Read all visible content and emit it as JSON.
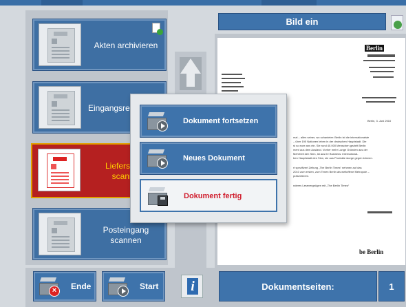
{
  "left_list": {
    "items": [
      {
        "label": "Akten archivieren",
        "active": false
      },
      {
        "label": "Eingangsre",
        "active": false
      },
      {
        "label": "Lieferschei\nscanne",
        "active": true
      },
      {
        "label": "Posteingang\nscannen",
        "active": false
      }
    ]
  },
  "right_panel": {
    "header": "Bild ein"
  },
  "preview": {
    "logo_top": "Berlin",
    "logo_bottom": "be Berlin",
    "date": "Berlin, 3. Juni 2010",
    "body_lines": [
      "mal – allen seiner, wo schanieter: Berlin ist die internationalste",
      "– über 190 Nationen leben in der deutschen Hauptstadt. Die",
      "st so eure ans ein. Sie rund 40.000 Menschen gezielt Berlin",
      "ment aus dem Ausland. Vorher mehr Lange Gründen aus der",
      "Mehrheit den Sinn, ist aus ihr Business: international-",
      "ben Hauptstadt den Sinn, sie aus Produkte storge gegen können."
    ],
    "body_lines_2": [
      "rt spezifizert Zeitung „The Berlin Times“ nehmen auf das",
      "2010 zum ersten, zum Tenen Berlin als weltoffene Metropole –",
      "präsentieren."
    ],
    "closing": "nderes Lesevergnügen mit „The Berlin Times“"
  },
  "popup_menu": {
    "continue_label": "Dokument fortsetzen",
    "new_label": "Neues Dokument",
    "finish_label": "Dokument fertig"
  },
  "bottom_bar": {
    "end_label": "Ende",
    "start_label": "Start",
    "info_glyph": "i",
    "pages_label": "Dokumentseiten:",
    "pages_count": "1"
  },
  "colors": {
    "accent_blue": "#3e73ab",
    "active_red": "#b52020",
    "active_border": "#e2a000",
    "finish_text": "#d01e2e"
  },
  "icons": [
    "document-thumbnail-icon",
    "scanner-icon",
    "cancel-icon",
    "play-icon",
    "disk-icon",
    "info-icon",
    "arrow-up-icon",
    "checkmark-icon",
    "new-document-icon"
  ]
}
